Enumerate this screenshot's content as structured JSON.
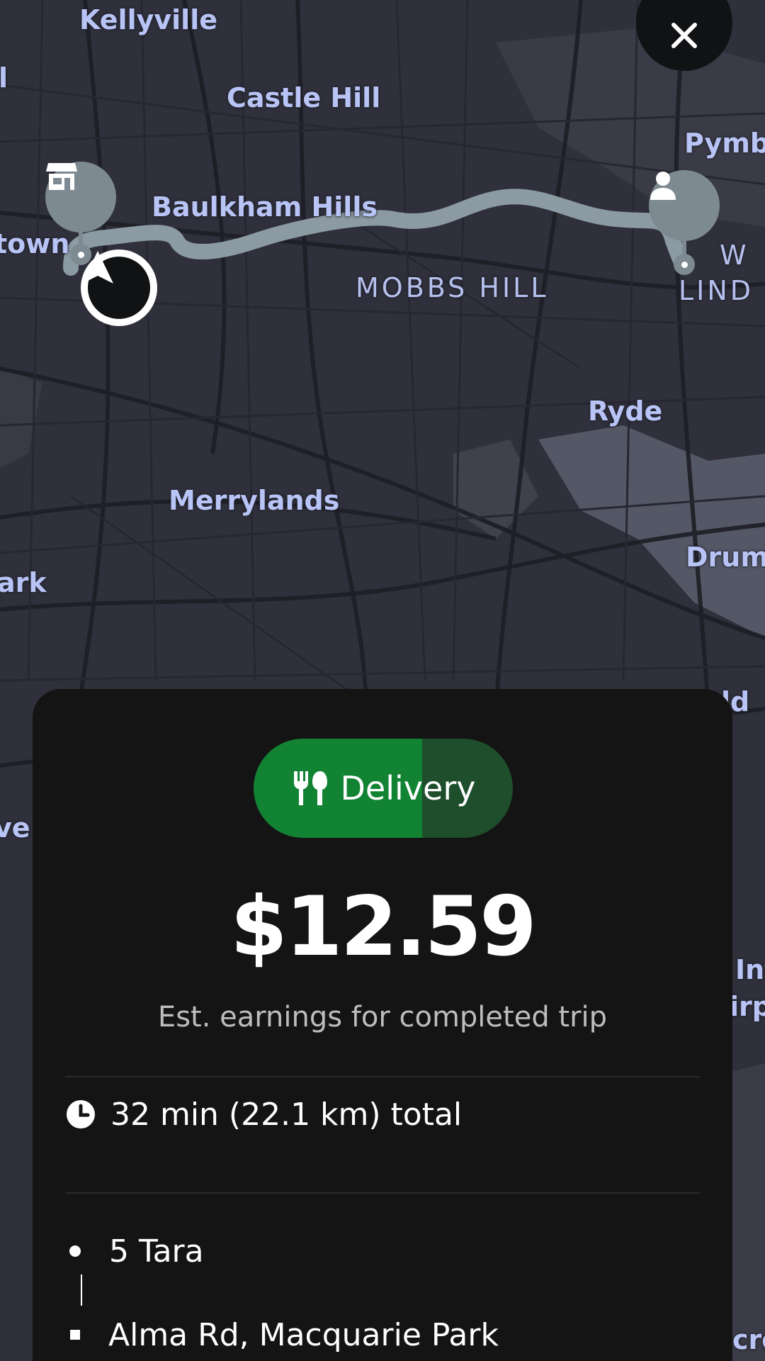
{
  "map": {
    "labels": {
      "kellyville": "Kellyville",
      "castle_hill": "Castle Hill",
      "pymble": "Pymb",
      "baulkham_hills": "Baulkham Hills",
      "town": "town",
      "left_l": "l",
      "mobbs_hill": "MOBBS HILL",
      "west": "W",
      "lindfield": "LIND",
      "ryde": "Ryde",
      "merrylands": "Merrylands",
      "drummoyne": "Drum",
      "park": "ark",
      "ld": "ld",
      "ve": "ve",
      "int": "Int",
      "airp": "irp",
      "cro": "cro"
    },
    "route_color": "#8c9ba3",
    "pin_color": "#7e8a91"
  },
  "close_button": {
    "icon": "close-icon"
  },
  "pins": {
    "store_icon": "store-icon",
    "customer_icon": "person-icon",
    "navigation_icon": "navigation-arrow-icon"
  },
  "card": {
    "trip_type": {
      "label": "Delivery",
      "icon": "utensils-icon",
      "progress": 0.65,
      "colors": {
        "fill": "#128233",
        "track": "#1e4e2b"
      }
    },
    "earnings": "$12.59",
    "earnings_label": "Est. earnings for completed trip",
    "duration": {
      "icon": "clock-icon",
      "text": "32 min (22.1 km) total"
    },
    "stops": [
      {
        "icon": "pickup-dot-icon",
        "text": "5 Tara"
      },
      {
        "icon": "dropoff-square-icon",
        "text": "Alma Rd, Macquarie Park"
      }
    ]
  }
}
